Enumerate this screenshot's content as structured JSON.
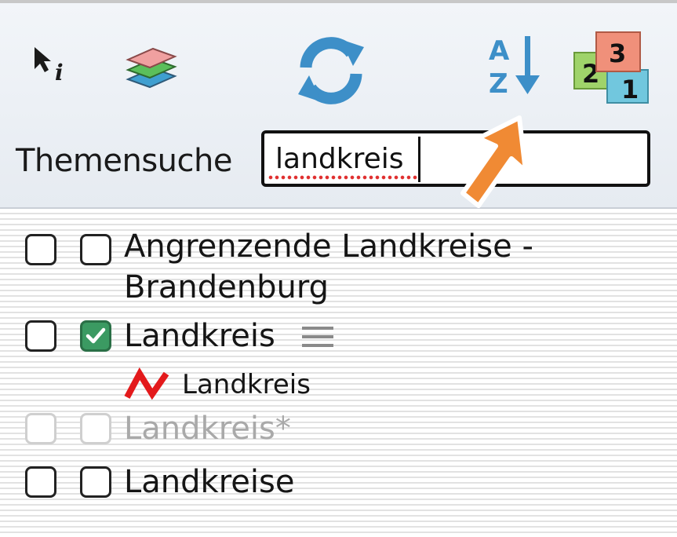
{
  "toolbar": {
    "info_icon": "pointer-info-icon",
    "layers_icon": "layers-icon",
    "refresh_icon": "refresh-icon",
    "sort_az_icon": "sort-alphabetical-icon",
    "sort_az_letters": [
      "A",
      "Z"
    ],
    "sort_order_icon": "sort-numeric-icon",
    "sort_order_numbers": [
      "3",
      "2",
      "1"
    ]
  },
  "search": {
    "label": "Themensuche",
    "value": "landkreis"
  },
  "results": [
    {
      "label_line1": "Angrenzende Landkreise -",
      "label_line2": "Brandenburg",
      "checked": false
    },
    {
      "label": "Landkreis",
      "checked": true,
      "legend": "Landkreis"
    },
    {
      "label": "Landkreis*",
      "checked": false,
      "disabled": true
    },
    {
      "label": "Landkreise",
      "checked": false
    }
  ],
  "colors": {
    "accent_blue": "#3d8fc8",
    "checked_green": "#3b9a62",
    "legend_red": "#e3191b",
    "highlight_arrow": "#f08a34"
  }
}
